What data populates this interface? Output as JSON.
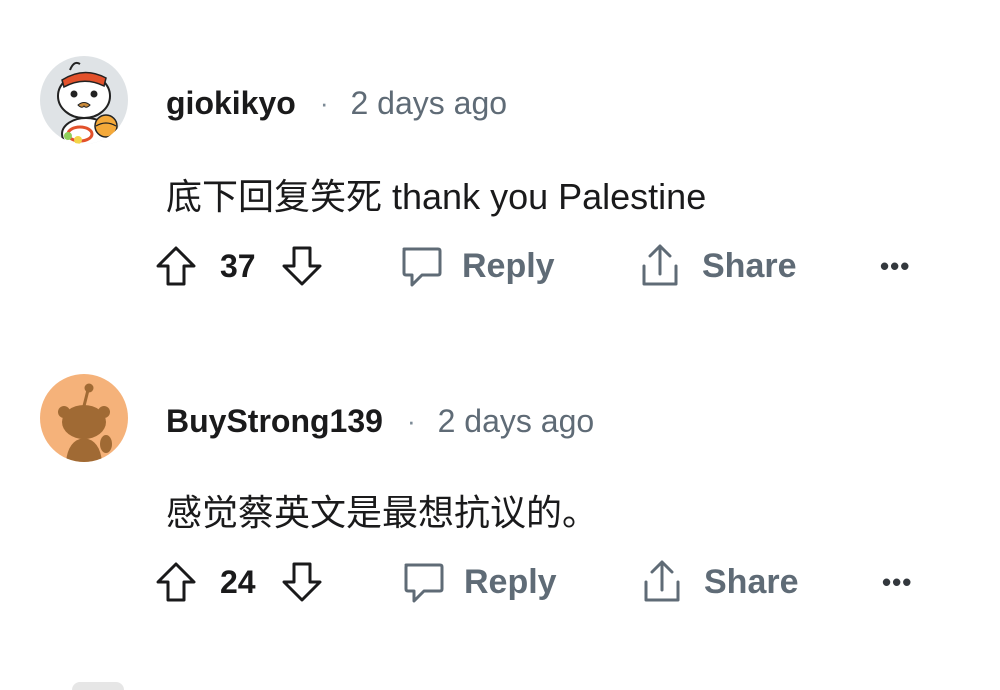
{
  "comments": [
    {
      "username": "giokikyo",
      "separator": "·",
      "timestamp": "2 days ago",
      "body": "底下回复笑死 thank you Palestine",
      "votes": "37",
      "reply_label": "Reply",
      "share_label": "Share",
      "more_label": "•••",
      "avatar_icon": "character-avatar-icon"
    },
    {
      "username": "BuyStrong139",
      "separator": "·",
      "timestamp": "2 days ago",
      "body": "感觉蔡英文是最想抗议的。",
      "votes": "24",
      "reply_label": "Reply",
      "share_label": "Share",
      "more_label": "•••",
      "avatar_icon": "snoo-avatar-icon"
    }
  ],
  "colors": {
    "avatar_bg_1": "#dfe3e6",
    "avatar_bg_2": "#f5b27a",
    "meta_gray": "#5f6b76",
    "text_dark": "#1a1a1b"
  }
}
